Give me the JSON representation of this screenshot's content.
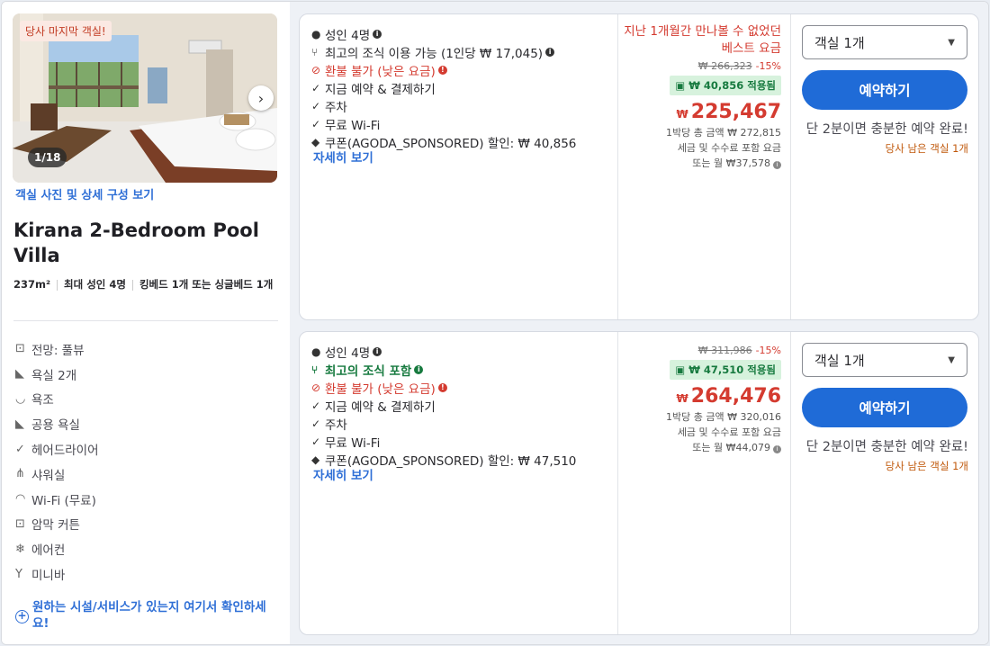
{
  "room": {
    "photo_badge": "당사 마지막 객실!",
    "photo_count": "1/18",
    "photo_link": "객실 사진 및 상세 구성 보기",
    "title": "Kirana 2-Bedroom Pool Villa",
    "size": "237m²",
    "max_guests": "최대 성인 4명",
    "beds": "킹베드 1개 또는 싱글베드 1개",
    "amenities": [
      {
        "icon": "view-icon",
        "label": "전망: 풀뷰"
      },
      {
        "icon": "bathroom-icon",
        "label": "욕실 2개"
      },
      {
        "icon": "bathtub-icon",
        "label": "욕조"
      },
      {
        "icon": "shared-bathroom-icon",
        "label": "공용 욕실"
      },
      {
        "icon": "check-icon",
        "label": "헤어드라이어"
      },
      {
        "icon": "shower-icon",
        "label": "샤워실"
      },
      {
        "icon": "wifi-icon",
        "label": "Wi-Fi (무료)"
      },
      {
        "icon": "blackout-curtain-icon",
        "label": "암막 커튼"
      },
      {
        "icon": "air-conditioner-icon",
        "label": "에어컨"
      },
      {
        "icon": "minibar-icon",
        "label": "미니바"
      }
    ],
    "facility_link": "원하는 시설/서비스가 있는지 여기서 확인하세요!"
  },
  "offers": [
    {
      "guests": "성인 4명",
      "breakfast": "최고의 조식 이용 가능 (1인당 ₩ 17,045)",
      "breakfast_included": false,
      "refund": "환불 불가 (낮은 요금)",
      "pay_now": "지금 예약 & 결제하기",
      "parking": "주차",
      "wifi": "무료 Wi-Fi",
      "coupon": "쿠폰(AGODA_SPONSORED) 할인: ₩ 40,856",
      "details": "자세히 보기",
      "best_price": "지난 1개월간 만나볼 수 없었던 베스트 요금",
      "original_price": "₩ 266,323",
      "discount": "-15%",
      "coupon_applied": "₩ 40,856 적용됨",
      "currency": "₩",
      "price": "225,467",
      "total_per_night": "1박당 총 금액 ₩ 272,815",
      "tax_note": "세금 및 수수료 포함 요금",
      "monthly": "또는 월 ₩37,578",
      "rooms_select": "객실 1개",
      "book_label": "예약하기",
      "hint": "단 2분이면 충분한 예약 완료!",
      "rooms_left": "당사 남은 객실 1개"
    },
    {
      "guests": "성인 4명",
      "breakfast": "최고의 조식 포함",
      "breakfast_included": true,
      "refund": "환불 불가 (낮은 요금)",
      "pay_now": "지금 예약 & 결제하기",
      "parking": "주차",
      "wifi": "무료 Wi-Fi",
      "coupon": "쿠폰(AGODA_SPONSORED) 할인: ₩ 47,510",
      "details": "자세히 보기",
      "original_price": "₩ 311,986",
      "discount": "-15%",
      "coupon_applied": "₩ 47,510 적용됨",
      "currency": "₩",
      "price": "264,476",
      "total_per_night": "1박당 총 금액 ₩ 320,016",
      "tax_note": "세금 및 수수료 포함 요금",
      "monthly": "또는 월 ₩44,079",
      "rooms_select": "객실 1개",
      "book_label": "예약하기",
      "hint": "단 2분이면 충분한 예약 완료!",
      "rooms_left": "당사 남은 객실 1개"
    }
  ],
  "colors": {
    "accent": "#1f6bd7",
    "price_red": "#d43b30",
    "included_green": "#177a3f",
    "link_blue": "#2f6fd6"
  }
}
